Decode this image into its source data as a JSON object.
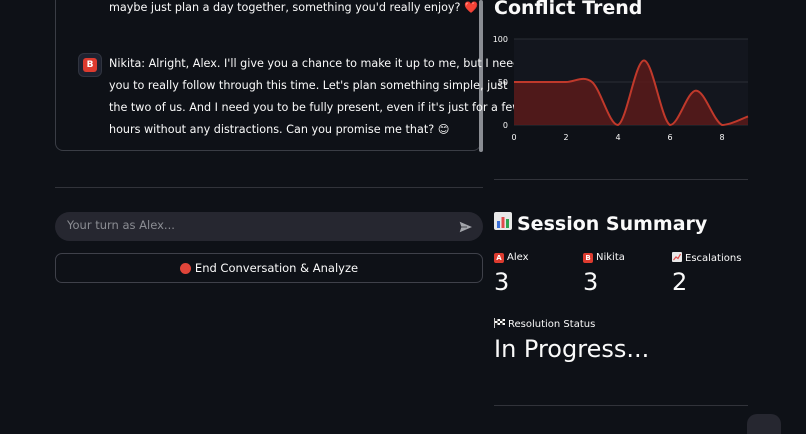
{
  "chat": {
    "prev_message_tail": "maybe just plan a day together, something you'd really enjoy? ❤️",
    "nikita_message_lines": [
      "Nikita: Alright, Alex. I'll give you a chance to make it up to me, but I need",
      "you to really follow through this time. Let's plan something simple, just",
      "the two of us. And I need you to be fully present, even if it's just for a few",
      "hours without any distractions. Can you promise me that? 😊"
    ],
    "avatar_letter": "B"
  },
  "input": {
    "placeholder": "Your turn as Alex..."
  },
  "end_button": {
    "label": "End Conversation & Analyze"
  },
  "chart": {
    "title": "Conflict Trend",
    "line_color": "#c0392b"
  },
  "chart_data": {
    "type": "area",
    "x": [
      0,
      1,
      2,
      3,
      4,
      5,
      6,
      7,
      8,
      9
    ],
    "y": [
      50,
      50,
      50,
      50,
      0,
      75,
      0,
      40,
      0,
      10
    ],
    "xticks": [
      "0",
      "2",
      "4",
      "6",
      "8"
    ],
    "yticks": [
      "0",
      "50",
      "100"
    ],
    "xlim": [
      0,
      9
    ],
    "ylim": [
      0,
      100
    ],
    "grid": true
  },
  "summary": {
    "title": "Session Summary",
    "metrics": [
      {
        "badge": "A",
        "label": "Alex",
        "value": "3"
      },
      {
        "badge": "B",
        "label": "Nikita",
        "value": "3"
      },
      {
        "badge": "",
        "label": "Escalations",
        "value": "2"
      }
    ],
    "resolution_label": "Resolution Status",
    "resolution_value": "In Progress..."
  },
  "colors": {
    "background": "#0e1117",
    "accent_red": "#dd3b2f",
    "chart_fill": "#5a1a1a"
  }
}
